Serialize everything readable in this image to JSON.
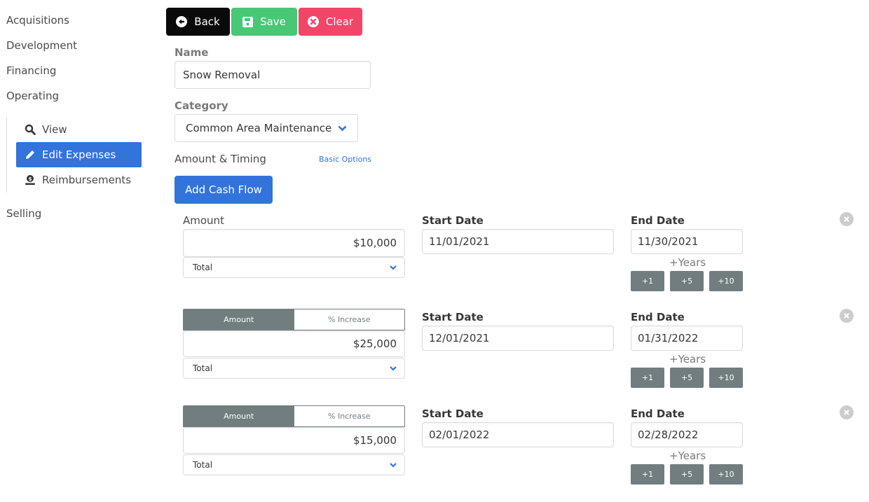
{
  "sidebar": {
    "items": [
      {
        "label": "Acquisitions"
      },
      {
        "label": "Development"
      },
      {
        "label": "Financing"
      },
      {
        "label": "Operating"
      },
      {
        "label": "Selling"
      }
    ],
    "submenu": [
      {
        "label": "View",
        "icon": "search-icon"
      },
      {
        "label": "Edit Expenses",
        "icon": "pencil-icon",
        "active": true
      },
      {
        "label": "Reimbursements",
        "icon": "money-hand-icon"
      }
    ]
  },
  "toolbar": {
    "back_label": "Back",
    "save_label": "Save",
    "clear_label": "Clear"
  },
  "colors": {
    "back": "#0a0a0a",
    "save": "#48c774",
    "clear": "#f14668",
    "primary": "#3273dc",
    "toggle": "#717d7e"
  },
  "form": {
    "name_label": "Name",
    "name_value": "Snow Removal",
    "category_label": "Category",
    "category_value": "Common Area Maintenance",
    "amount_timing_label": "Amount & Timing",
    "basic_options_link": "Basic Options",
    "add_cash_flow_label": "Add Cash Flow"
  },
  "cash_flows": [
    {
      "amount_label": "Amount",
      "amount_value": "$10,000",
      "period": "Total",
      "start_label": "Start Date",
      "start_value": "11/01/2021",
      "end_label": "End Date",
      "end_value": "11/30/2021",
      "years_label": "+Years",
      "year_buttons": [
        "+1",
        "+5",
        "+10"
      ]
    },
    {
      "toggle": [
        "Amount",
        "% Increase"
      ],
      "toggle_selected": "Amount",
      "amount_value": "$25,000",
      "period": "Total",
      "start_label": "Start Date",
      "start_value": "12/01/2021",
      "end_label": "End Date",
      "end_value": "01/31/2022",
      "years_label": "+Years",
      "year_buttons": [
        "+1",
        "+5",
        "+10"
      ]
    },
    {
      "toggle": [
        "Amount",
        "% Increase"
      ],
      "toggle_selected": "Amount",
      "amount_value": "$15,000",
      "period": "Total",
      "start_label": "Start Date",
      "start_value": "02/01/2022",
      "end_label": "End Date",
      "end_value": "02/28/2022",
      "years_label": "+Years",
      "year_buttons": [
        "+1",
        "+5",
        "+10"
      ]
    }
  ]
}
